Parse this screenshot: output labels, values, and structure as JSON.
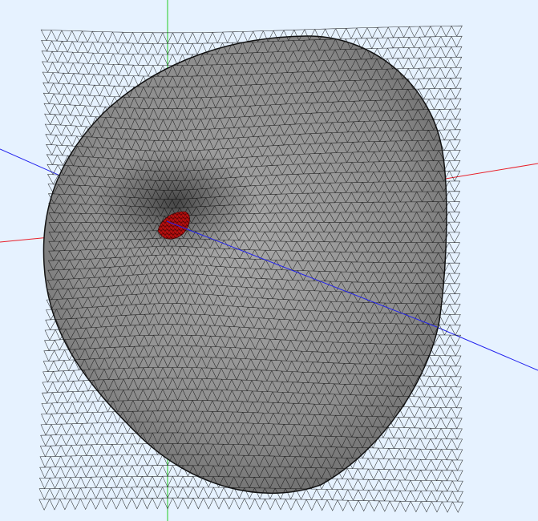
{
  "viewer": {
    "background_color": "#e6f2ff",
    "mesh": {
      "face_color": "#8f8f8f",
      "edge_color": "#111111",
      "inner_patch_color": "#c01010"
    },
    "axes": {
      "x_axis_color": "#e8202a",
      "y_axis_color": "#22cc22",
      "z_axis_color": "#2222ee"
    }
  }
}
